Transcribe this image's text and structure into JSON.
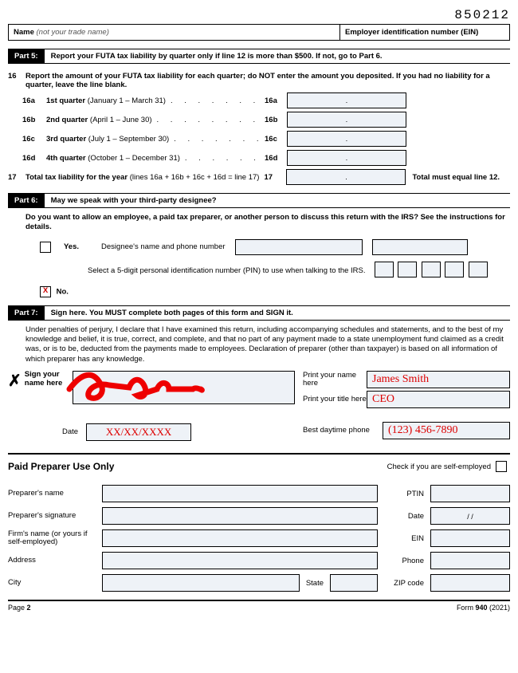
{
  "form_code": "850212",
  "header": {
    "name_label": "Name",
    "name_hint": "(not your trade name)",
    "ein_label": "Employer identification number (EIN)"
  },
  "part5": {
    "tag": "Part 5:",
    "title": "Report your FUTA tax liability by quarter only if line 12 is more than $500. If not, go to Part 6.",
    "line16_num": "16",
    "line16_text": "Report the amount of your FUTA tax liability for each quarter; do NOT enter the amount you deposited. If you had no liability for a quarter, leave the line blank.",
    "subs": [
      {
        "code": "16a",
        "bold": "1st quarter",
        "rest": " (January 1 – March 31)"
      },
      {
        "code": "16b",
        "bold": "2nd quarter",
        "rest": " (April 1 – June 30)"
      },
      {
        "code": "16c",
        "bold": "3rd quarter",
        "rest": " (July 1 – September 30)"
      },
      {
        "code": "16d",
        "bold": "4th quarter",
        "rest": " (October 1 – December 31)"
      }
    ],
    "line17_num": "17",
    "line17_bold": "Total tax liability for the year",
    "line17_rest": " (lines 16a + 16b + 16c + 16d = line 17)",
    "line17_code": "17",
    "line17_tail": "Total must equal line 12.",
    "box_dot": "."
  },
  "part6": {
    "tag": "Part 6:",
    "title": "May we speak with your third-party designee?",
    "instr": "Do you want to allow an employee, a paid tax preparer, or another person to discuss this return with the IRS? See the instructions for details.",
    "yes": "Yes.",
    "designee_label": "Designee's name and phone number",
    "pin_text": "Select a 5-digit personal identification number (PIN) to use when talking to the IRS.",
    "no_mark": "X",
    "no": "No."
  },
  "part7": {
    "tag": "Part 7:",
    "title": "Sign here. You MUST complete both pages of this form and SIGN it.",
    "perjury": "Under penalties of perjury, I declare that I have examined this return, including accompanying schedules and statements, and to the best of my knowledge and belief, it is true, correct, and complete, and that no part of any payment made to a state unemployment fund claimed as a credit was, or is to be, deducted from the payments made to employees. Declaration of preparer (other than taxpayer) is based on all information of which preparer has any knowledge.",
    "sign_x": "✗",
    "sign_label": "Sign your name here",
    "print_name_label": "Print your name here",
    "print_name_value": "James Smith",
    "print_title_label": "Print your title here",
    "print_title_value": "CEO",
    "date_label": "Date",
    "date_value": "XX/XX/XXXX",
    "phone_label": "Best daytime phone",
    "phone_value": "(123) 456-7890"
  },
  "preparer": {
    "header": "Paid Preparer Use Only",
    "self_employed": "Check if you are self-employed",
    "name": "Preparer's name",
    "ptin": "PTIN",
    "signature": "Preparer's signature",
    "date": "Date",
    "date_value": "/       /",
    "firm": "Firm's name (or yours if self-employed)",
    "ein": "EIN",
    "address": "Address",
    "phone": "Phone",
    "city": "City",
    "state": "State",
    "zip": "ZIP code"
  },
  "footer": {
    "page": "Page 2",
    "form": "Form 940 (2021)",
    "form_bold": "940"
  }
}
